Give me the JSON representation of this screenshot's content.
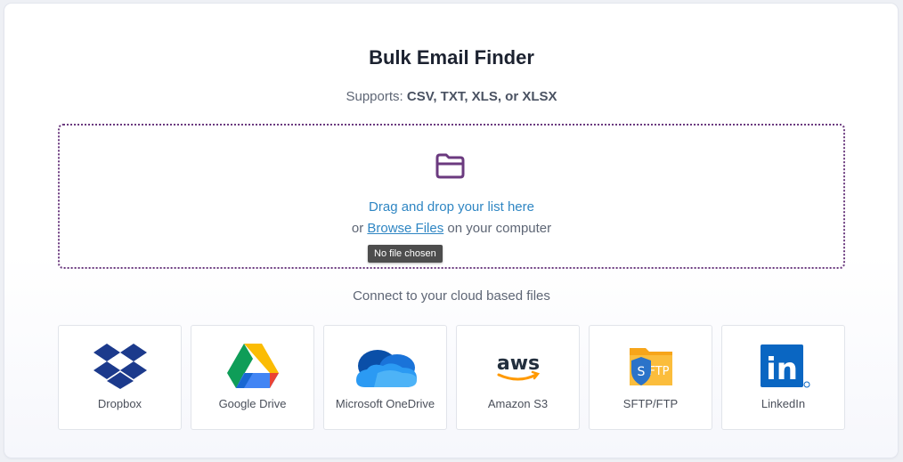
{
  "header": {
    "title": "Bulk Email Finder",
    "supports_prefix": "Supports: ",
    "supports_formats": "CSV, TXT, XLS, or XLSX"
  },
  "dropzone": {
    "icon": "folder-open-icon",
    "drag_text": "Drag and drop your list here",
    "browse_prefix": "or ",
    "browse_link": "Browse Files",
    "browse_suffix": " on your computer",
    "tooltip": "No file chosen"
  },
  "cloud": {
    "heading": "Connect to your cloud based files",
    "providers": [
      {
        "label": "Dropbox",
        "icon": "dropbox-icon"
      },
      {
        "label": "Google Drive",
        "icon": "google-drive-icon"
      },
      {
        "label": "Microsoft OneDrive",
        "icon": "onedrive-icon"
      },
      {
        "label": "Amazon S3",
        "icon": "aws-icon",
        "logo_text": "aws"
      },
      {
        "label": "SFTP/FTP",
        "icon": "sftp-icon",
        "logo_text": "FTP",
        "badge_text": "S"
      },
      {
        "label": "LinkedIn",
        "icon": "linkedin-icon",
        "logo_text": "in"
      }
    ]
  },
  "colors": {
    "accent_purple": "#6b3a7f",
    "link_blue": "#2f86c3"
  }
}
